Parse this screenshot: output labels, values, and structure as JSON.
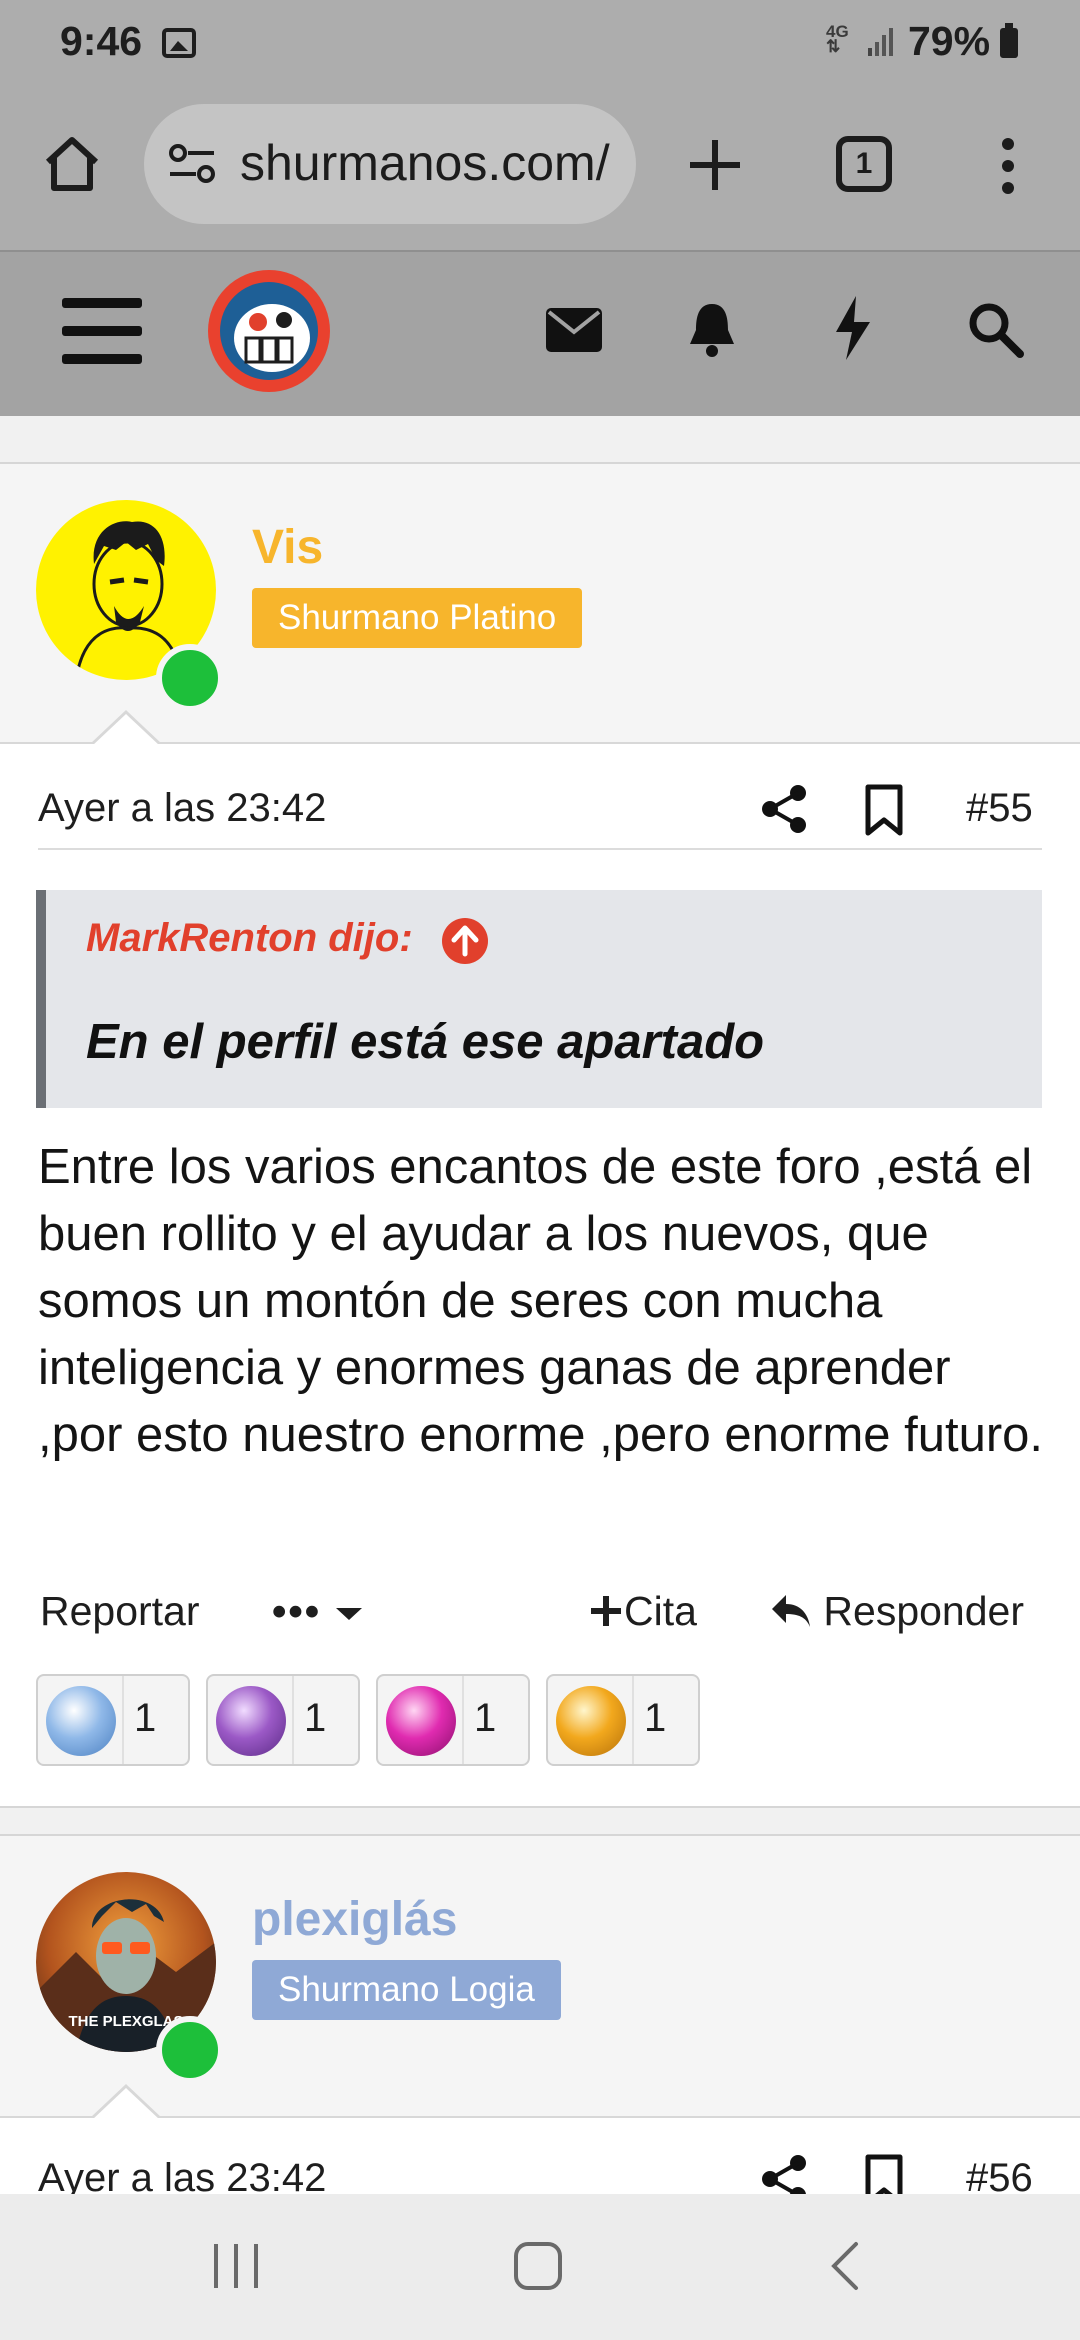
{
  "status_bar": {
    "time": "9:46",
    "network": "4G",
    "battery": "79%"
  },
  "browser": {
    "url": "shurmanos.com/",
    "tab_count": "1"
  },
  "posts": [
    {
      "username": "Vis",
      "username_color": "#f7b52c",
      "rank": "Shurmano Platino",
      "rank_color": "#f7b52c",
      "date": "Ayer a las 23:42",
      "number": "#55",
      "quote": {
        "author": "MarkRenton dijo:",
        "text": "En el perfil está ese apartado"
      },
      "body": "Entre los varios encantos de este foro ,está el buen rollito y el ayudar a los nuevos, que somos un montón de seres con mucha inteligencia y enormes ganas de aprender ,por esto nuestro enorme ,pero enorme futuro.",
      "actions": {
        "report": "Reportar",
        "more": "•••",
        "quote": "Cita",
        "reply": "Responder"
      },
      "reactions": [
        {
          "gem": "blue-gem",
          "color": "#8fb8e8",
          "count": "1"
        },
        {
          "gem": "purple-gem",
          "color": "#9b59c6",
          "count": "1"
        },
        {
          "gem": "pink-gem",
          "color": "#e02bb0",
          "count": "1"
        },
        {
          "gem": "gold-gem",
          "color": "#f2a81d",
          "count": "1"
        }
      ]
    },
    {
      "username": "plexiglás",
      "username_color": "#8fa9d6",
      "rank": "Shurmano Logia",
      "rank_color": "#8fa9d6",
      "date": "Ayer a las 23:42",
      "number": "#56",
      "avatar_caption": "THE PLEXGLAS"
    }
  ]
}
